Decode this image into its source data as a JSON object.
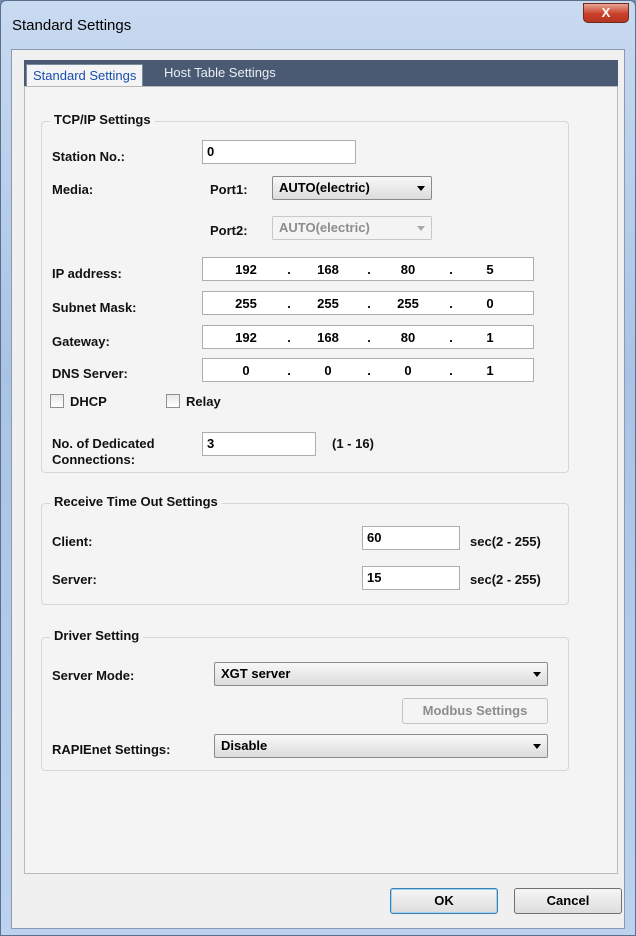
{
  "window": {
    "title": "Standard Settings",
    "close_glyph": "X"
  },
  "tabs": [
    {
      "label": "Standard Settings",
      "active": true
    },
    {
      "label": "Host Table Settings",
      "active": false
    }
  ],
  "tcpip": {
    "title": "TCP/IP Settings",
    "station_label": "Station No.:",
    "station_value": "0",
    "media_label": "Media:",
    "port1_label": "Port1:",
    "port1_value": "AUTO(electric)",
    "port2_label": "Port2:",
    "port2_value": "AUTO(electric)",
    "ip_label": "IP address:",
    "ip": [
      "192",
      "168",
      "80",
      "5"
    ],
    "subnet_label": "Subnet Mask:",
    "subnet": [
      "255",
      "255",
      "255",
      "0"
    ],
    "gateway_label": "Gateway:",
    "gateway": [
      "192",
      "168",
      "80",
      "1"
    ],
    "dns_label": "DNS Server:",
    "dns": [
      "0",
      "0",
      "0",
      "1"
    ],
    "dot": ".",
    "dhcp_label": "DHCP",
    "relay_label": "Relay",
    "dedicated_label_line1": "No. of Dedicated",
    "dedicated_label_line2": "Connections:",
    "dedicated_value": "3",
    "dedicated_range": "(1 - 16)"
  },
  "timeout": {
    "title": "Receive Time Out Settings",
    "client_label": "Client:",
    "client_value": "60",
    "client_unit": "sec(2 - 255)",
    "server_label": "Server:",
    "server_value": "15",
    "server_unit": "sec(2 - 255)"
  },
  "driver": {
    "title": "Driver Setting",
    "server_mode_label": "Server Mode:",
    "server_mode_value": "XGT server",
    "modbus_button": "Modbus Settings",
    "rapienet_label": "RAPIEnet Settings:",
    "rapienet_value": "Disable"
  },
  "buttons": {
    "ok": "OK",
    "cancel": "Cancel"
  }
}
